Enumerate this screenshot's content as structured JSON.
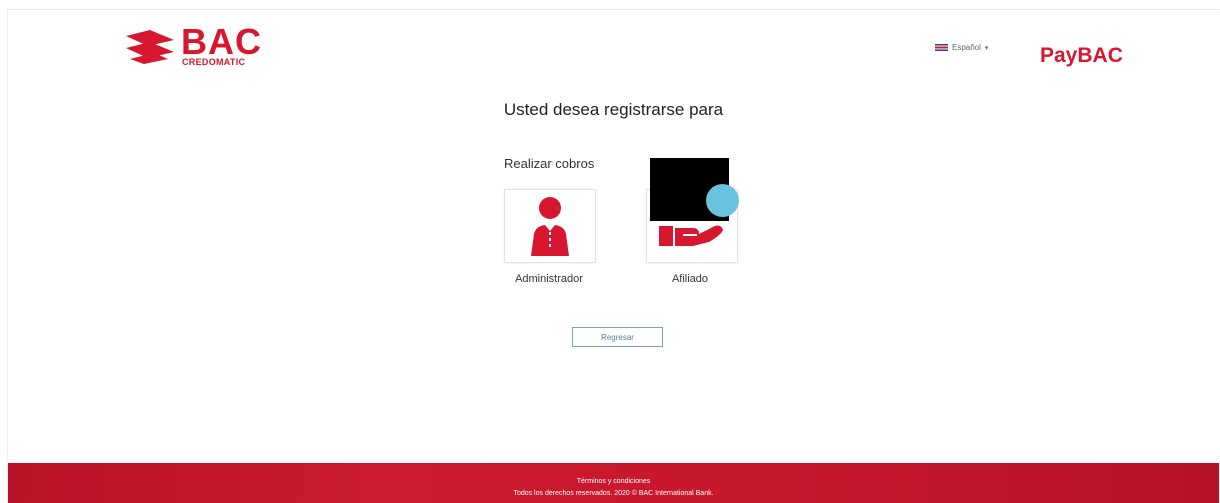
{
  "header": {
    "logo_text": "BAC",
    "logo_subtext": "CREDOMATIC",
    "language": "Español",
    "brand": "PayBAC"
  },
  "main": {
    "title": "Usted desea registrarse para",
    "options": [
      {
        "heading": "Realizar cobros",
        "label": "Administrador",
        "icon": "person-icon"
      },
      {
        "heading": "",
        "label": "Afiliado",
        "icon": "hand-icon"
      }
    ],
    "back_button": "Regresar"
  },
  "footer": {
    "terms_link": "Términos y condiciones",
    "copyright": "Todos los derechos reservados. 2020 © BAC International Bank."
  },
  "colors": {
    "brand_red": "#d7172f",
    "cursor_blue": "#69c2de"
  }
}
